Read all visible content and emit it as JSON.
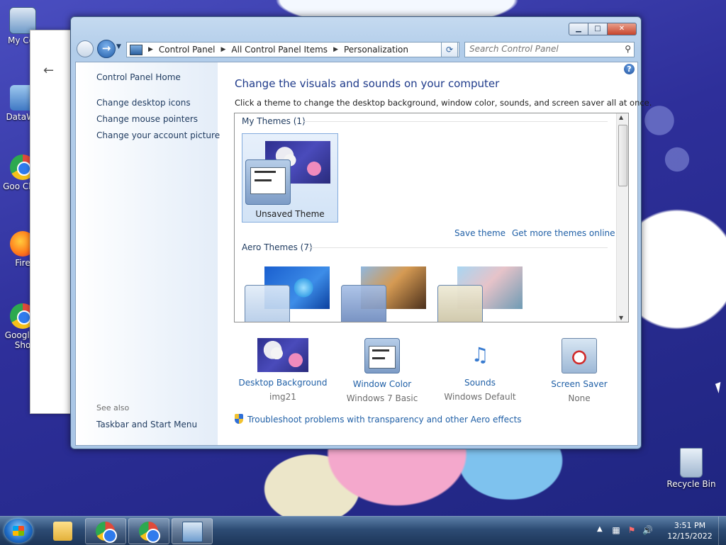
{
  "desktop": {
    "icons": [
      {
        "label": "My Cor",
        "icon": "computer-icon"
      },
      {
        "label": "DataWa",
        "icon": "app-shortcut-icon"
      },
      {
        "label": "Goo Chro",
        "icon": "chrome-icon"
      },
      {
        "label": "Fire",
        "icon": "firefox-icon"
      },
      {
        "label": "Google - Sho",
        "icon": "chrome-icon"
      }
    ],
    "recycle_bin": "Recycle Bin"
  },
  "window": {
    "address": {
      "crumbs": [
        "Control Panel",
        "All Control Panel Items",
        "Personalization"
      ]
    },
    "search_placeholder": "Search Control Panel",
    "left_pane": {
      "home": "Control Panel Home",
      "links": [
        "Change desktop icons",
        "Change mouse pointers",
        "Change your account picture"
      ],
      "see_also_label": "See also",
      "see_also_links": [
        "Taskbar and Start Menu"
      ]
    },
    "main": {
      "title": "Change the visuals and sounds on your computer",
      "subtitle": "Click a theme to change the desktop background, window color, sounds, and screen saver all at once.",
      "my_themes_label": "My Themes (1)",
      "my_themes": [
        {
          "name": "Unsaved Theme",
          "selected": true
        }
      ],
      "save_theme": "Save theme",
      "get_more": "Get more themes online",
      "aero_themes_label": "Aero Themes (7)",
      "aero_themes_visible": [
        "windows-7",
        "architecture",
        "nature"
      ],
      "settings": [
        {
          "label": "Desktop Background",
          "value": "img21",
          "icon": "desktop-background-icon"
        },
        {
          "label": "Window Color",
          "value": "Windows 7 Basic",
          "icon": "window-color-icon"
        },
        {
          "label": "Sounds",
          "value": "Windows Default",
          "icon": "sounds-icon"
        },
        {
          "label": "Screen Saver",
          "value": "None",
          "icon": "screen-saver-icon"
        }
      ],
      "troubleshoot": "Troubleshoot problems with transparency and other Aero effects"
    }
  },
  "taskbar": {
    "time": "3:51 PM",
    "date": "12/15/2022",
    "pinned": [
      "file-explorer-icon",
      "chrome-icon",
      "chrome-icon",
      "control-panel-icon"
    ]
  },
  "colors": {
    "link": "#1f5fa6",
    "title": "#1e3a8a",
    "selection": "#d2e3f6",
    "desktop": "#2e2f9a"
  }
}
